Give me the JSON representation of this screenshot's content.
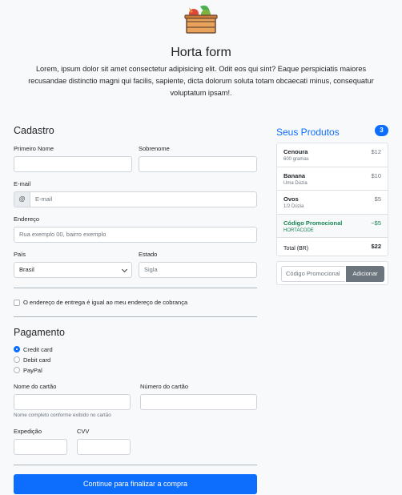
{
  "header": {
    "logo_icon": "vegetable-crate-icon",
    "title": "Horta form",
    "lead": "Lorem, ipsum dolor sit amet consectetur adipisicing elit. Odit eos qui sint? Eaque perspiciatis maiores recusandae distinctio magni qui facilis, sapiente, dicta dolorum soluta totam obcaecati minus, consequatur voluptatum ipsam!."
  },
  "cadastro": {
    "heading": "Cadastro",
    "first_name_label": "Primeiro Nome",
    "first_name_value": "",
    "last_name_label": "Sobrenome",
    "last_name_value": "",
    "email_label": "E-mail",
    "email_addon": "@",
    "email_placeholder": "E-mail",
    "address_label": "Endereço",
    "address_placeholder": "Rua exemplo 00, bairro exemplo",
    "country_label": "País",
    "country_value": "Brasil",
    "state_label": "Estado",
    "state_placeholder": "Sigla",
    "same_address_label": "O endereço de entrega é igual ao meu endereço de cobrança"
  },
  "pagamento": {
    "heading": "Pagamento",
    "methods": [
      {
        "label": "Credit card",
        "selected": true
      },
      {
        "label": "Debit card",
        "selected": false
      },
      {
        "label": "PayPal",
        "selected": false
      }
    ],
    "card_name_label": "Nome do cartão",
    "card_name_help": "Nome completo conforme exibido no cartão",
    "card_number_label": "Número do cartão",
    "expiry_label": "Expedição",
    "cvv_label": "CVV",
    "submit_label": "Continue para finalizar a compra"
  },
  "cart": {
    "title": "Seus Produtos",
    "count": "3",
    "items": [
      {
        "name": "Cenoura",
        "desc": "600 gramas",
        "price": "$12"
      },
      {
        "name": "Banana",
        "desc": "Uma Dúzia",
        "price": "$10"
      },
      {
        "name": "Ovos",
        "desc": "1/2 Dúzia",
        "price": "$5"
      }
    ],
    "promo": {
      "name": "Código Promocional",
      "code": "HORTACODE",
      "discount": "−$5"
    },
    "total_label": "Total (BR)",
    "total_value": "$22",
    "promo_placeholder": "Código Promocional",
    "promo_button": "Adicionar"
  },
  "colors": {
    "primary": "#0d6efd",
    "secondary": "#6c757d",
    "success": "#198754",
    "background": "#f8f9fa"
  }
}
